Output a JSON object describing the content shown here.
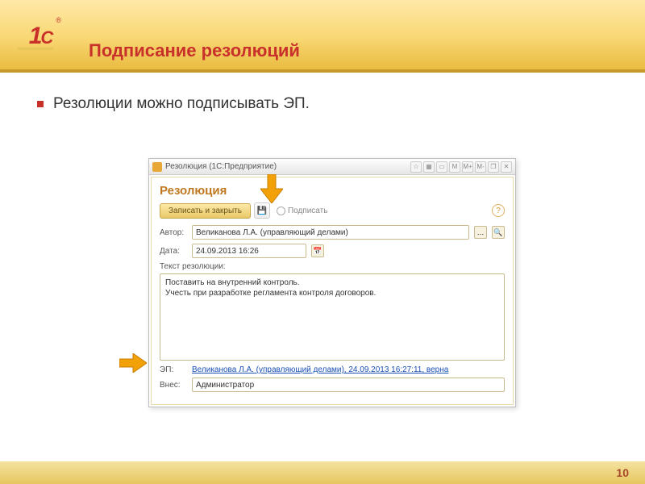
{
  "slide": {
    "title": "Подписание резолюций",
    "bullet": "Резолюции можно подписывать ЭП.",
    "page_number": "10"
  },
  "window": {
    "titlebar": "Резолюция  (1С:Предприятие)",
    "tb_buttons": {
      "m": "M",
      "m_plus": "M+",
      "m_minus": "M-"
    },
    "form_title": "Резолюция",
    "toolbar": {
      "save_close": "Записать и закрыть",
      "sign": "Подписать"
    },
    "fields": {
      "author_label": "Автор:",
      "author_value": "Великанова Л.А. (управляющий делами)",
      "date_label": "Дата:",
      "date_value": "24.09.2013 16:26",
      "text_label": "Текст резолюции:",
      "text_value": "Поставить на внутренний контроль.\nУчесть при разработке регламента контроля договоров.",
      "ep_label": "ЭП:",
      "ep_link": "Великанова Л.А. (управляющий делами), 24.09.2013 16:27:11, верна",
      "vnes_label": "Внес:",
      "vnes_value": "Администратор"
    }
  }
}
